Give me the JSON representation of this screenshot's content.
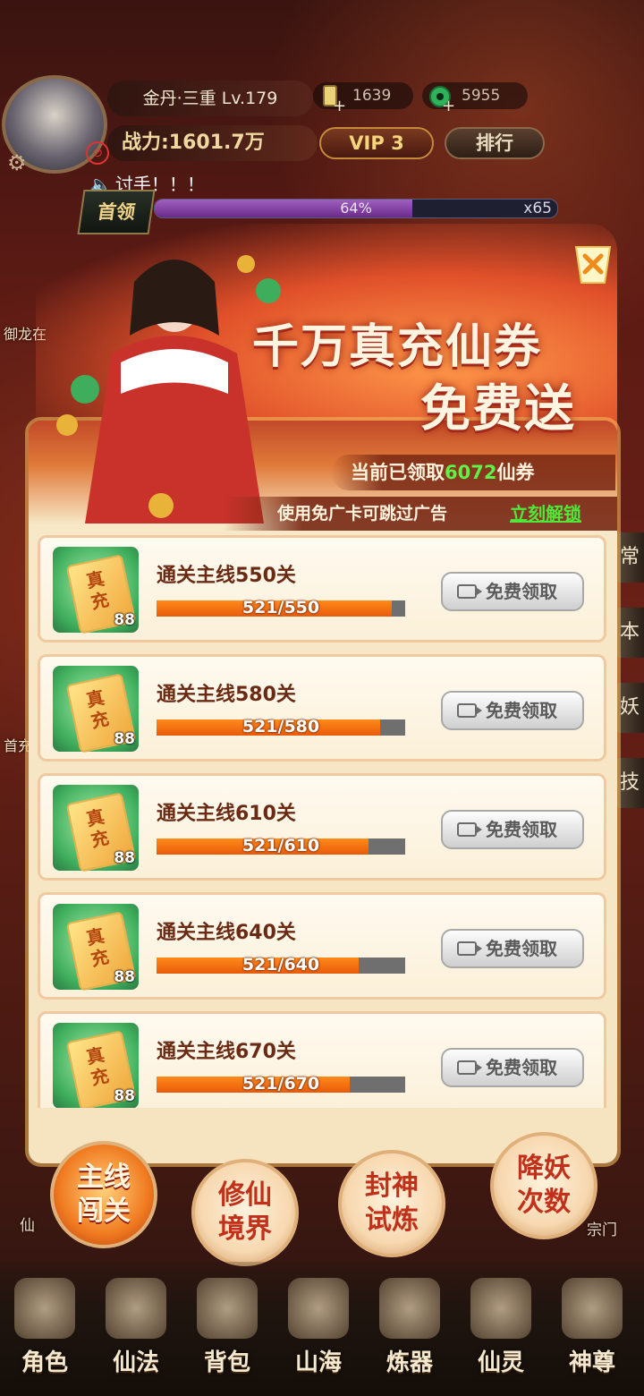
{
  "hud": {
    "realm_level": "金丹·三重 Lv.179",
    "currency1": "1639",
    "currency2": "5955",
    "power": "战力:1601.7万",
    "vip": "VIP 3",
    "rank_button": "排行",
    "ticker": "讨手！！！",
    "first_kill": "首领",
    "boss_progress": 64,
    "boss_progress_text": "64%",
    "boss_multiplier": "x65"
  },
  "side_left": {
    "labels": [
      "御龙在",
      "首充"
    ]
  },
  "side_right": {
    "tabs": [
      "常",
      "本",
      "妖",
      "技"
    ]
  },
  "popup": {
    "title_line1": "千万真充仙券",
    "title_line2": "免费送",
    "claimed_prefix": "当前已领取",
    "claimed_count": "6072",
    "claimed_suffix": "仙券",
    "hint": "使用免广卡可跳过广告",
    "unlock_link": "立刻解锁",
    "tasks": [
      {
        "label": "通关主线550关",
        "current": 521,
        "target": 550,
        "progress_text": "521/550",
        "reward_qty": "88",
        "reward_text": "真充",
        "button": "免费领取"
      },
      {
        "label": "通关主线580关",
        "current": 521,
        "target": 580,
        "progress_text": "521/580",
        "reward_qty": "88",
        "reward_text": "真充",
        "button": "免费领取"
      },
      {
        "label": "通关主线610关",
        "current": 521,
        "target": 610,
        "progress_text": "521/610",
        "reward_qty": "88",
        "reward_text": "真充",
        "button": "免费领取"
      },
      {
        "label": "通关主线640关",
        "current": 521,
        "target": 640,
        "progress_text": "521/640",
        "reward_qty": "88",
        "reward_text": "真充",
        "button": "免费领取"
      },
      {
        "label": "通关主线670关",
        "current": 521,
        "target": 670,
        "progress_text": "521/670",
        "reward_qty": "88",
        "reward_text": "真充",
        "button": "免费领取"
      }
    ]
  },
  "shortcuts": [
    {
      "line1": "主线",
      "line2": "闯关",
      "active": true
    },
    {
      "line1": "修仙",
      "line2": "境界",
      "active": false
    },
    {
      "line1": "封神",
      "line2": "试炼",
      "active": false
    },
    {
      "line1": "降妖",
      "line2": "次数",
      "active": false
    }
  ],
  "lower_texts": {
    "left": "仙",
    "right": "宗门"
  },
  "nav": [
    "角色",
    "仙法",
    "背包",
    "山海",
    "炼器",
    "仙灵",
    "神尊"
  ],
  "colors": {
    "accent_green": "#4fe83a",
    "title_red": "#a2281a",
    "bar_orange": "#e85a0a"
  }
}
